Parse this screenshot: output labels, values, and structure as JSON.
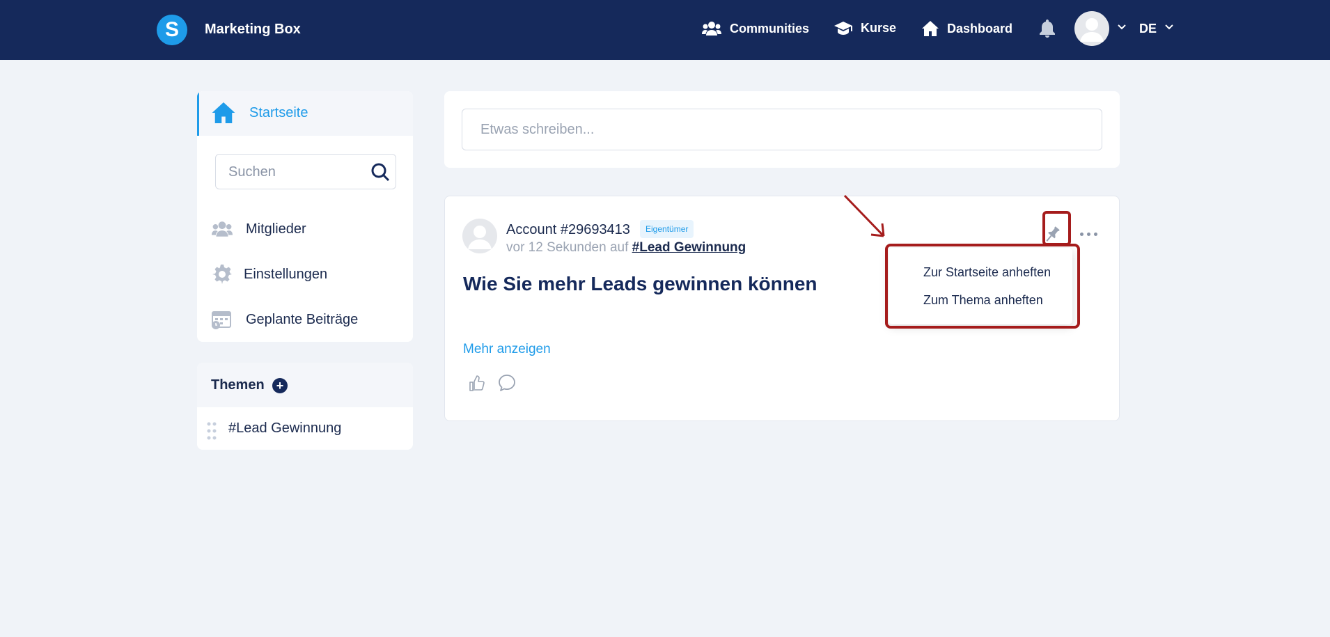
{
  "header": {
    "logo_letter": "S",
    "brand": "Marketing Box",
    "nav": [
      {
        "label": "Communities",
        "icon": "users-icon"
      },
      {
        "label": "Kurse",
        "icon": "graduation-cap-icon"
      },
      {
        "label": "Dashboard",
        "icon": "home-icon"
      }
    ],
    "language": "DE"
  },
  "sidebar": {
    "home_label": "Startseite",
    "search_placeholder": "Suchen",
    "items": [
      {
        "label": "Mitglieder",
        "icon": "members-icon"
      },
      {
        "label": "Einstellungen",
        "icon": "gear-icon"
      },
      {
        "label": "Geplante Beiträge",
        "icon": "calendar-icon"
      }
    ],
    "themes_title": "Themen",
    "themes": [
      {
        "label": "#Lead Gewinnung"
      }
    ]
  },
  "composer": {
    "placeholder": "Etwas schreiben..."
  },
  "post": {
    "author": "Account #29693413",
    "role_badge": "Eigentümer",
    "time_text": "vor 12 Sekunden auf",
    "topic": "#Lead Gewinnung",
    "title": "Wie Sie mehr Leads gewinnen können",
    "more_link": "Mehr anzeigen"
  },
  "pin_menu": {
    "items": [
      {
        "label": "Zur Startseite anheften"
      },
      {
        "label": "Zum Thema anheften"
      }
    ]
  },
  "colors": {
    "header_bg": "#15295b",
    "accent": "#1e9be9",
    "highlight": "#a51c1c",
    "page_bg": "#f0f3f8"
  }
}
